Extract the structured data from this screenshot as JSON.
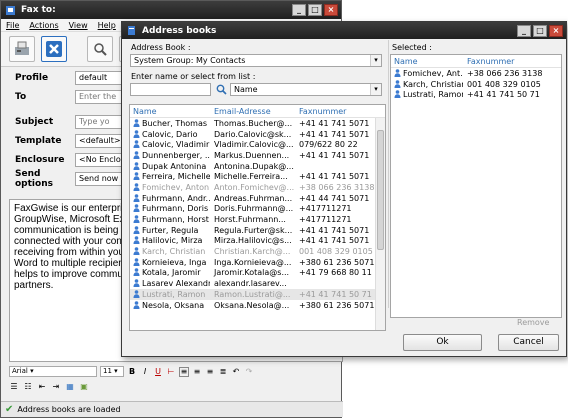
{
  "fax_window": {
    "title": "Fax to:",
    "menu": [
      "File",
      "Actions",
      "View",
      "Help"
    ],
    "fields": [
      {
        "label": "Profile",
        "value": "default"
      },
      {
        "label": "To",
        "value": "Enter the"
      },
      {
        "label": "Subject",
        "value": "Type yo"
      },
      {
        "label": "Template",
        "value": "<default>"
      },
      {
        "label": "Enclosure",
        "value": "<No Enclo"
      },
      {
        "label": "Send options",
        "value": "Send now"
      }
    ],
    "body_lines": [
      "FaxGwise is our enterprise",
      "GroupWise, Microsoft Exc",
      "communication is being m",
      "connected with your conta",
      "receiving from within your",
      "Word to multiple recipient",
      "helps to improve commun",
      "partners."
    ],
    "font_name": "Arial",
    "font_size": "11",
    "status": "Address books are loaded"
  },
  "dialog": {
    "title": "Address books",
    "address_book_label": "Address Book :",
    "address_book_value": "System Group: My Contacts",
    "search_label": "Enter name or select from list :",
    "search_value": "",
    "filter_value": "Name",
    "columns": [
      "Name",
      "Email-Adresse",
      "Faxnummer"
    ],
    "contacts": [
      {
        "name": "Bucher, Thomas",
        "email": "Thomas.Bucher@...",
        "fax": "+41 41 741 5071",
        "grey": false
      },
      {
        "name": "Calovic, Dario",
        "email": "Dario.Calovic@sk...",
        "fax": "+41 41 741 5071",
        "grey": false
      },
      {
        "name": "Calovic, Vladimir",
        "email": "Vladimir.Calovic@...",
        "fax": "079/622 80 22",
        "grey": false
      },
      {
        "name": "Dunnenberger, ...",
        "email": "Markus.Duennen...",
        "fax": "+41 41 741 5071",
        "grey": false
      },
      {
        "name": "Dupak Antonina",
        "email": "Antonina.Dupak@...",
        "fax": "",
        "grey": false
      },
      {
        "name": "Ferreira, Michelle",
        "email": "Michelle.Ferreira...",
        "fax": "+41 41 741 5071",
        "grey": false
      },
      {
        "name": "Fomichev, Anton",
        "email": "Anton.Fomichev@...",
        "fax": "+38 066 236 3138",
        "grey": true
      },
      {
        "name": "Fuhrmann, Andr...",
        "email": "Andreas.Fuhrman...",
        "fax": "+41 44 741 5071",
        "grey": false
      },
      {
        "name": "Fuhrmann, Doris",
        "email": "Doris.Fuhrmann@...",
        "fax": "+417711271",
        "grey": false
      },
      {
        "name": "Fuhrmann, Horst",
        "email": "Horst.Fuhrmann...",
        "fax": "+417711271",
        "grey": false
      },
      {
        "name": "Furter, Regula",
        "email": "Regula.Furter@sk...",
        "fax": "+41 41 741 5071",
        "grey": false
      },
      {
        "name": "Halilovic, Mirza",
        "email": "Mirza.Halilovic@s...",
        "fax": "+41 41 741 5071",
        "grey": false
      },
      {
        "name": "Karch, Christian",
        "email": "Christian.Karch@...",
        "fax": "001 408 329 0105",
        "grey": true
      },
      {
        "name": "Kornieieva, Inga",
        "email": "Inga.Kornieieva@...",
        "fax": "+380 61 236 5071",
        "grey": false
      },
      {
        "name": "Kotala, Jaromir",
        "email": "Jaromir.Kotala@s...",
        "fax": "+41 79 668 80 11",
        "grey": false
      },
      {
        "name": "Lasarev Alexandr",
        "email": "alexandr.lasarev...",
        "fax": "",
        "grey": false
      },
      {
        "name": "Lustrati, Ramon",
        "email": "Ramon.Lustrati@...",
        "fax": "+41 41 741 50 71",
        "grey": true,
        "selected": true
      },
      {
        "name": "Nesola, Oksana",
        "email": "Oksana.Nesola@...",
        "fax": "+380 61 236 5071",
        "grey": false
      }
    ],
    "selected_label": "Selected :",
    "selected_columns": [
      "Name",
      "Faxnummer"
    ],
    "selected": [
      {
        "name": "Fomichev, Ant...",
        "fax": "+38 066 236 3138"
      },
      {
        "name": "Karch, Christian",
        "fax": "001 408 329 0105"
      },
      {
        "name": "Lustrati, Ramon",
        "fax": "+41 41 741 50 71"
      }
    ],
    "remove_label": "Remove",
    "ok_label": "Ok",
    "cancel_label": "Cancel"
  },
  "colors": {
    "accent": "#2f6fb3",
    "title_bar": "#2b2b2b",
    "close": "#c94a3a"
  }
}
